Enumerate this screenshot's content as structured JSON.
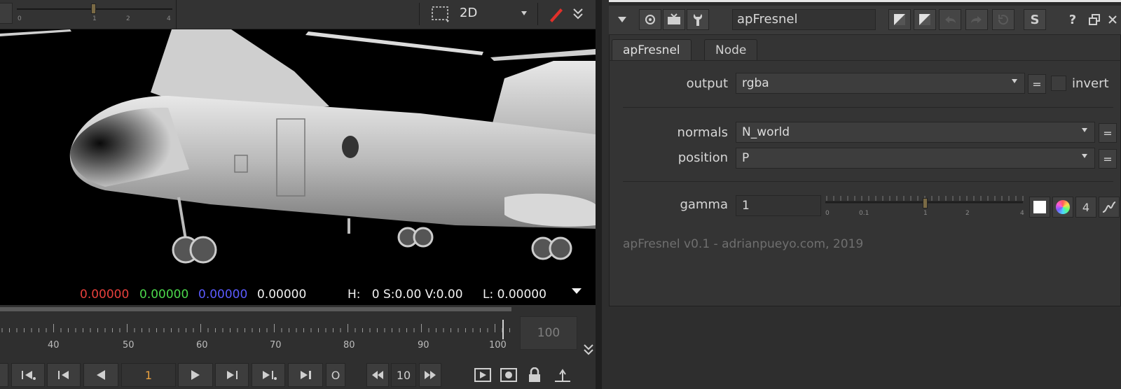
{
  "viewer": {
    "gain_ticks": [
      "0",
      "1",
      "2",
      "4"
    ],
    "viewer_mode": "2D",
    "readout": {
      "r": "0.00000",
      "g": "0.00000",
      "b": "0.00000",
      "a": "0.00000",
      "hsv": "H:   0 S:0.00 V:0.00",
      "luma": "L: 0.00000"
    },
    "colors": {
      "r": "#e8403c",
      "g": "#4cd94c",
      "b": "#5b5bff",
      "a": "#f2f2f2",
      "accent": "#e8a040",
      "pen": "#e0302a"
    }
  },
  "timeline": {
    "frame_labels": [
      "40",
      "50",
      "60",
      "70",
      "80",
      "90",
      "100"
    ],
    "end_frame": "100",
    "current_frame": "1",
    "increment": "10",
    "o_label": "O"
  },
  "properties": {
    "node_name": "apFresnel",
    "tabs": [
      {
        "label": "apFresnel"
      },
      {
        "label": "Node"
      }
    ],
    "output": {
      "label": "output",
      "value": "rgba",
      "invert_label": "invert",
      "eq": "="
    },
    "normals": {
      "label": "normals",
      "value": "N_world",
      "eq": "="
    },
    "position": {
      "label": "position",
      "value": "P",
      "eq": "="
    },
    "gamma": {
      "label": "gamma",
      "value": "1",
      "ticks": [
        "0",
        "0.1",
        "1",
        "2",
        "4"
      ],
      "channels": "4"
    },
    "footer": "apFresnel v0.1 - adrianpueyo.com, 2019",
    "header_buttons": {
      "help": "?",
      "s": "S"
    }
  }
}
